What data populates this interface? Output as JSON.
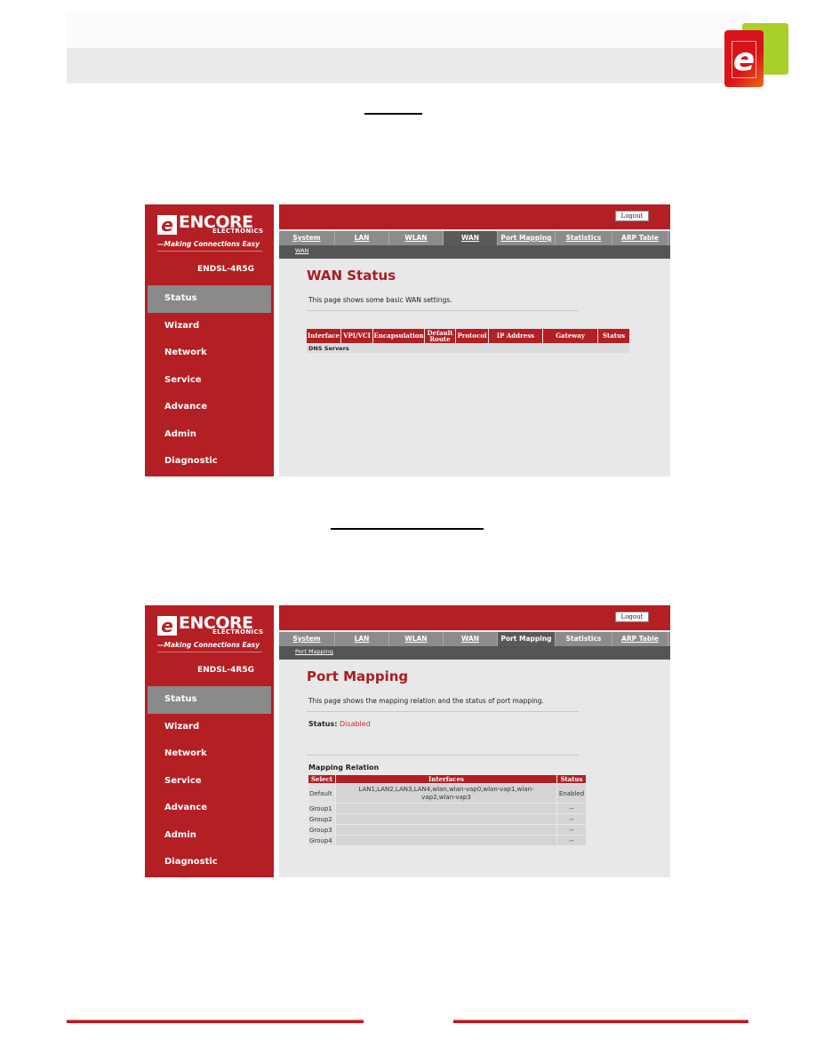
{
  "document": {
    "brand_logo": "encore-e-logo-icon",
    "colors": {
      "brand_red": "#b41f24",
      "accent_green": "#a9cf2a",
      "status_disabled": "#d22b2b"
    }
  },
  "screens": [
    {
      "logo": {
        "e": "e",
        "name": "ENCORE",
        "sub": "ELECTRONICS",
        "registered": "®",
        "tagline": "—Making Connections Easy"
      },
      "model": "ENDSL-4R5G",
      "nav": [
        "Status",
        "Wizard",
        "Network",
        "Service",
        "Advance",
        "Admin",
        "Diagnostic"
      ],
      "active_nav": "Status",
      "logout_label": "Logout",
      "tabs": [
        "System",
        "LAN",
        "WLAN",
        "WAN",
        "Port Mapping",
        "Statistics",
        "ARP Table"
      ],
      "active_tab": "WAN",
      "subnav": "WAN",
      "title": "WAN Status",
      "description": "This page shows some basic WAN settings.",
      "table_headers": [
        "Interface",
        "VPI/VCI",
        "Encapsulation",
        "Default Route",
        "Protocol",
        "IP Address",
        "Gateway",
        "Status"
      ],
      "dns_label": "DNS Servers"
    },
    {
      "logo": {
        "e": "e",
        "name": "ENCORE",
        "sub": "ELECTRONICS",
        "registered": "®",
        "tagline": "—Making Connections Easy"
      },
      "model": "ENDSL-4R5G",
      "nav": [
        "Status",
        "Wizard",
        "Network",
        "Service",
        "Advance",
        "Admin",
        "Diagnostic"
      ],
      "active_nav": "Status",
      "logout_label": "Logout",
      "tabs": [
        "System",
        "LAN",
        "WLAN",
        "WAN",
        "Port Mapping",
        "Statistics",
        "ARP Table"
      ],
      "active_tab": "Port Mapping",
      "subnav": "Port Mapping",
      "title": "Port Mapping",
      "description": "This page shows the mapping relation and the status of port mapping.",
      "status_label": "Status:",
      "status_value": "Disabled",
      "mapping_title": "Mapping Relation",
      "mapping_headers": [
        "Select",
        "Interfaces",
        "Status"
      ],
      "mapping_rows": [
        {
          "select": "Default",
          "interfaces": "LAN1,LAN2,LAN3,LAN4,wlan,wlan-vap0,wlan-vap1,wlan-vap2,wlan-vap3",
          "status": "Enabled"
        },
        {
          "select": "Group1",
          "interfaces": "",
          "status": "--"
        },
        {
          "select": "Group2",
          "interfaces": "",
          "status": "--"
        },
        {
          "select": "Group3",
          "interfaces": "",
          "status": "--"
        },
        {
          "select": "Group4",
          "interfaces": "",
          "status": "--"
        }
      ]
    }
  ]
}
